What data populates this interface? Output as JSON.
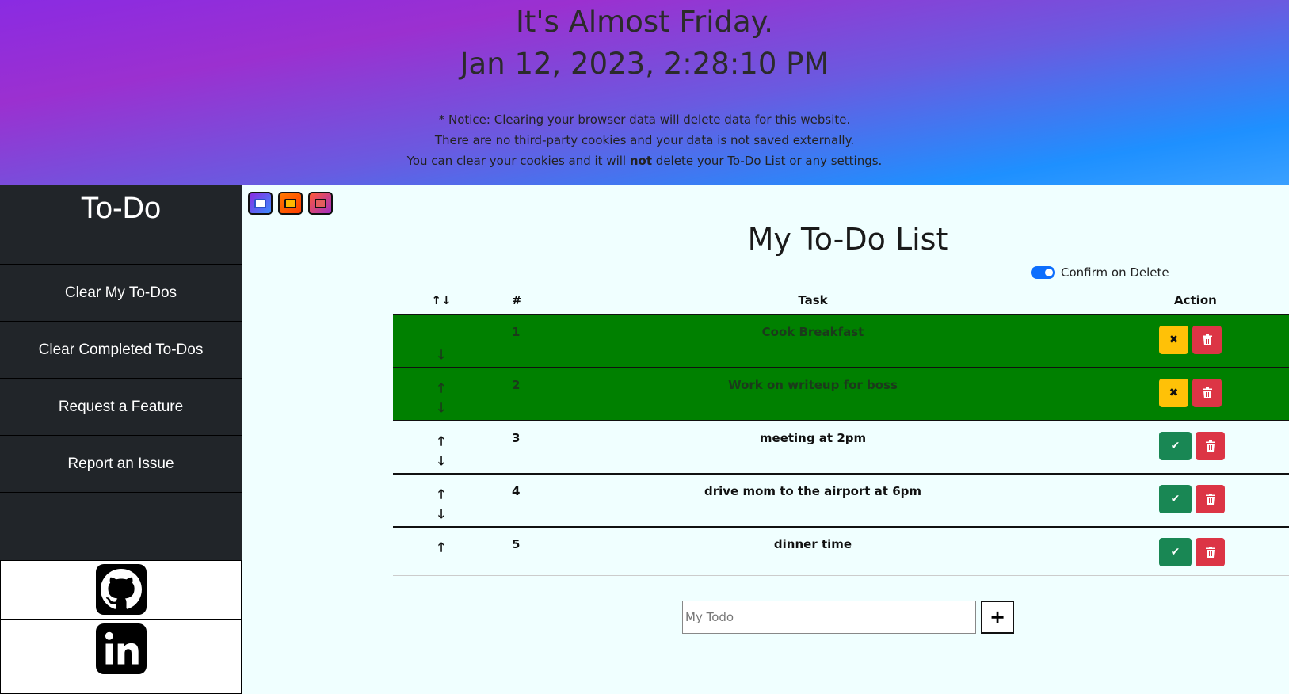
{
  "header": {
    "title": "It's Almost Friday.",
    "datetime": "Jan 12, 2023, 2:28:10 PM",
    "notice_line1": "* Notice: Clearing your browser data will delete data for this website.",
    "notice_line2": "There are no third-party cookies and your data is not saved externally.",
    "notice_line3_a": "You can clear your cookies and it will ",
    "notice_line3_b": "not",
    "notice_line3_c": " delete your To-Do List or any settings."
  },
  "sidebar": {
    "brand": "To-Do",
    "items": [
      {
        "label": "Clear My To-Dos"
      },
      {
        "label": "Clear Completed To-Dos"
      },
      {
        "label": "Request a Feature"
      },
      {
        "label": "Report an Issue"
      }
    ],
    "social": [
      {
        "icon": "github-icon"
      },
      {
        "icon": "linkedin-icon"
      }
    ]
  },
  "themes": [
    {
      "name": "purple-blue-theme"
    },
    {
      "name": "orange-theme"
    },
    {
      "name": "sunset-theme"
    }
  ],
  "main": {
    "title": "My To-Do List",
    "confirm_label": "Confirm on Delete",
    "confirm_on": true
  },
  "table": {
    "headers": {
      "arrows": "↑↓",
      "num": "#",
      "task": "Task",
      "action": "Action"
    },
    "rows": [
      {
        "num": "1",
        "task": "Cook Breakfast",
        "completed": true,
        "up": false,
        "down": true
      },
      {
        "num": "2",
        "task": "Work on writeup for boss",
        "completed": true,
        "up": true,
        "down": true
      },
      {
        "num": "3",
        "task": "meeting at 2pm",
        "completed": false,
        "up": true,
        "down": true
      },
      {
        "num": "4",
        "task": "drive mom to the airport at 6pm",
        "completed": false,
        "up": true,
        "down": true
      },
      {
        "num": "5",
        "task": "dinner time",
        "completed": false,
        "up": true,
        "down": false
      }
    ]
  },
  "add": {
    "placeholder": "My Todo",
    "button": "+"
  },
  "colors": {
    "completed_row": "#008000",
    "sidebar": "#212529",
    "content_bg": "#f0ffff"
  }
}
